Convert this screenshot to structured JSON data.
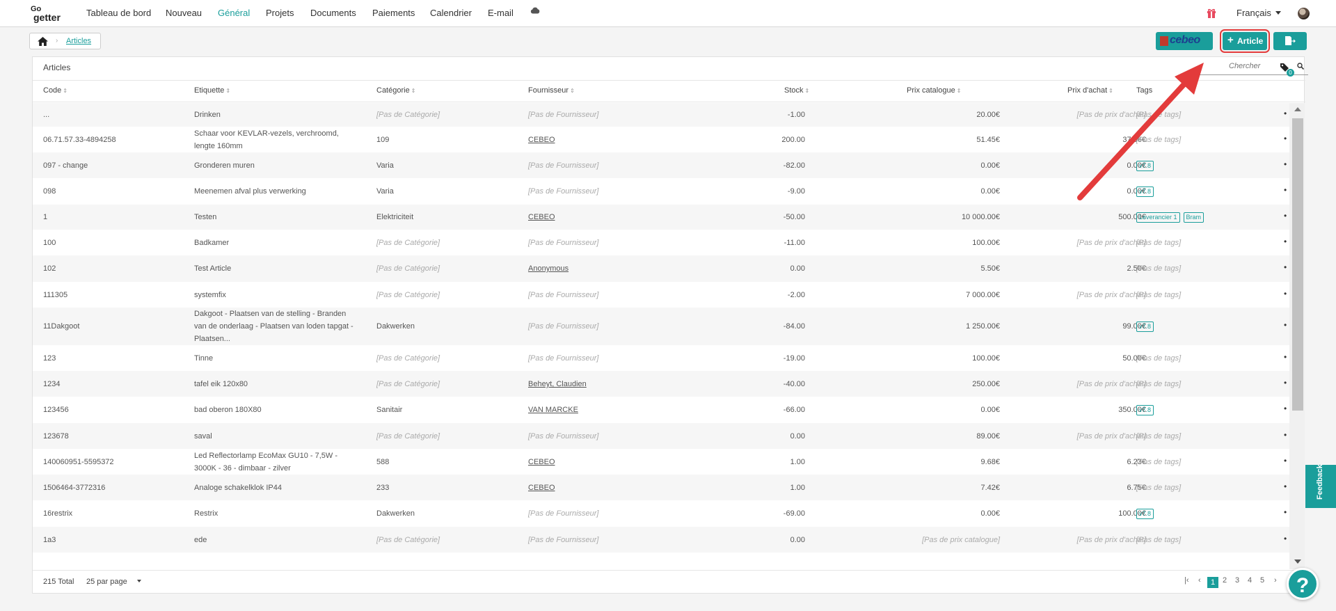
{
  "nav": {
    "logo_top": "Go",
    "logo_bottom": "getter",
    "items": [
      {
        "label": "Tableau de bord",
        "active": false
      },
      {
        "label": "Nouveau",
        "active": false
      },
      {
        "label": "Général",
        "active": true
      },
      {
        "label": "Projets",
        "active": false
      },
      {
        "label": "Documents",
        "active": false
      },
      {
        "label": "Paiements",
        "active": false
      },
      {
        "label": "Calendrier",
        "active": false
      },
      {
        "label": "E-mail",
        "active": false
      }
    ],
    "cloud_icon": "cloud-icon",
    "gift_icon": "gift-icon",
    "language": "Français"
  },
  "breadcrumb": {
    "home_icon": "home-icon",
    "current": "Articles"
  },
  "actions": {
    "cebeo_label": "cebeo",
    "add_article_label": "Article",
    "export_icon": "export-icon"
  },
  "card": {
    "title": "Articles",
    "search_placeholder": "Chercher",
    "tags_count": "0"
  },
  "table": {
    "columns": [
      "Code",
      "Etiquette",
      "Catégorie",
      "Fournisseur",
      "Stock",
      "Prix catalogue",
      "Prix d'achat",
      "Tags"
    ],
    "rows": [
      {
        "code": "...",
        "label": [
          "Drinken"
        ],
        "category": "[Pas de Catégorie]",
        "supplier": "[Pas de Fournisseur]",
        "stock": "-1.00",
        "catalog": "20.00€",
        "purchase": "[Pas de prix d'achat]",
        "tags": []
      },
      {
        "code": "06.71.57.33-4894258",
        "label": [
          "Schaar voor KEVLAR-vezels, verchroomd,",
          "lengte 160mm"
        ],
        "category": "109",
        "supplier": "CEBEO",
        "stock": "200.00",
        "catalog": "51.45€",
        "purchase": "37.56€",
        "tags": []
      },
      {
        "code": "097 - change",
        "label": [
          "Gronderen muren"
        ],
        "category": "Varia",
        "supplier": "[Pas de Fournisseur]",
        "stock": "-82.00",
        "catalog": "0.00€",
        "purchase": "0.00€",
        "tags": [
          "v7.8"
        ]
      },
      {
        "code": "098",
        "label": [
          "Meenemen afval plus verwerking"
        ],
        "category": "Varia",
        "supplier": "[Pas de Fournisseur]",
        "stock": "-9.00",
        "catalog": "0.00€",
        "purchase": "0.00€",
        "tags": [
          "v7.8"
        ]
      },
      {
        "code": "1",
        "label": [
          "Testen"
        ],
        "category": "Elektriciteit",
        "supplier": "CEBEO",
        "stock": "-50.00",
        "catalog": "10 000.00€",
        "purchase": "500.00€",
        "tags": [
          "Leverancier 1",
          "Bram"
        ]
      },
      {
        "code": "100",
        "label": [
          "Badkamer"
        ],
        "category": "[Pas de Catégorie]",
        "supplier": "[Pas de Fournisseur]",
        "stock": "-11.00",
        "catalog": "100.00€",
        "purchase": "[Pas de prix d'achat]",
        "tags": []
      },
      {
        "code": "102",
        "label": [
          "Test Article"
        ],
        "category": "[Pas de Catégorie]",
        "supplier": "Anonymous",
        "stock": "0.00",
        "catalog": "5.50€",
        "purchase": "2.50€",
        "tags": []
      },
      {
        "code": "111305",
        "label": [
          "systemfix"
        ],
        "category": "[Pas de Catégorie]",
        "supplier": "[Pas de Fournisseur]",
        "stock": "-2.00",
        "catalog": "7 000.00€",
        "purchase": "[Pas de prix d'achat]",
        "tags": []
      },
      {
        "code": "11Dakgoot",
        "label": [
          "Dakgoot - Plaatsen van de stelling - Branden",
          "van de onderlaag - Plaatsen van loden tapgat -",
          "Plaatsen..."
        ],
        "category": "Dakwerken",
        "supplier": "[Pas de Fournisseur]",
        "stock": "-84.00",
        "catalog": "1 250.00€",
        "purchase": "99.00€",
        "tags": [
          "v7.8"
        ]
      },
      {
        "code": "123",
        "label": [
          "Tinne"
        ],
        "category": "[Pas de Catégorie]",
        "supplier": "[Pas de Fournisseur]",
        "stock": "-19.00",
        "catalog": "100.00€",
        "purchase": "50.00€",
        "tags": []
      },
      {
        "code": "1234",
        "label": [
          "tafel eik 120x80"
        ],
        "category": "[Pas de Catégorie]",
        "supplier": "Beheyt, Claudien",
        "stock": "-40.00",
        "catalog": "250.00€",
        "purchase": "[Pas de prix d'achat]",
        "tags": []
      },
      {
        "code": "123456",
        "label": [
          "bad oberon 180X80"
        ],
        "category": "Sanitair",
        "supplier": "VAN MARCKE",
        "stock": "-66.00",
        "catalog": "0.00€",
        "purchase": "350.00€",
        "tags": [
          "v7.8"
        ]
      },
      {
        "code": "123678",
        "label": [
          "saval"
        ],
        "category": "[Pas de Catégorie]",
        "supplier": "[Pas de Fournisseur]",
        "stock": "0.00",
        "catalog": "89.00€",
        "purchase": "[Pas de prix d'achat]",
        "tags": []
      },
      {
        "code": "140060951-5595372",
        "label": [
          "Led Reflectorlamp EcoMax GU10 - 7,5W -",
          "3000K - 36 - dimbaar - zilver"
        ],
        "category": "588",
        "supplier": "CEBEO",
        "stock": "1.00",
        "catalog": "9.68€",
        "purchase": "6.23€",
        "tags": []
      },
      {
        "code": "1506464-3772316",
        "label": [
          "Analoge schakelklok IP44"
        ],
        "category": "233",
        "supplier": "CEBEO",
        "stock": "1.00",
        "catalog": "7.42€",
        "purchase": "6.75€",
        "tags": []
      },
      {
        "code": "16restrix",
        "label": [
          "Restrix"
        ],
        "category": "Dakwerken",
        "supplier": "[Pas de Fournisseur]",
        "stock": "-69.00",
        "catalog": "0.00€",
        "purchase": "100.00€",
        "tags": [
          "v7.8"
        ]
      },
      {
        "code": "1a3",
        "label": [
          "ede"
        ],
        "category": "[Pas de Catégorie]",
        "supplier": "[Pas de Fournisseur]",
        "stock": "0.00",
        "catalog": "[Pas de prix catalogue]",
        "purchase": "[Pas de prix d'achat]",
        "tags": []
      }
    ],
    "no_tags": "[Pas de tags]"
  },
  "footer": {
    "total": "215 Total",
    "per_page": "25 par page",
    "pages": [
      "1",
      "2",
      "3",
      "4",
      "5"
    ],
    "active_page": "1"
  },
  "feedback_label": "Feedback",
  "help_label": "?",
  "colors": {
    "accent": "#1a9e9b",
    "highlight": "#e33b3b"
  }
}
